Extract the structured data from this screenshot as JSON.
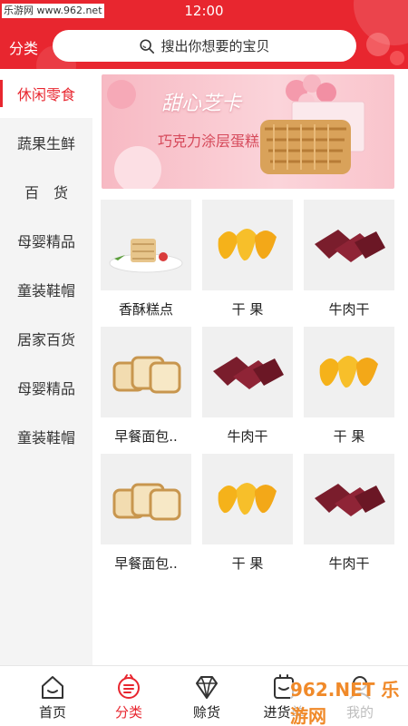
{
  "status": {
    "watermark": "乐游网 www.962.net",
    "time": "12:00"
  },
  "header": {
    "category_label": "分类",
    "search_placeholder": "搜出你想要的宝贝"
  },
  "sidebar": {
    "items": [
      {
        "label": "休闲零食",
        "active": true
      },
      {
        "label": "蔬果生鲜",
        "active": false
      },
      {
        "label": "百　货",
        "active": false
      },
      {
        "label": "母婴精品",
        "active": false
      },
      {
        "label": "童装鞋帽",
        "active": false
      },
      {
        "label": "居家百货",
        "active": false
      },
      {
        "label": "母婴精品",
        "active": false
      },
      {
        "label": "童装鞋帽",
        "active": false
      }
    ]
  },
  "banner": {
    "script_text": "甜心芝卡",
    "title": "巧克力涂层蛋糕"
  },
  "products": [
    {
      "label": "香酥糕点",
      "image": "pastry-plate"
    },
    {
      "label": "干 果",
      "image": "dried-mango"
    },
    {
      "label": "牛肉干",
      "image": "beef-jerky"
    },
    {
      "label": "早餐面包..",
      "image": "bread-slices"
    },
    {
      "label": "牛肉干",
      "image": "beef-jerky"
    },
    {
      "label": "干 果",
      "image": "dried-mango"
    },
    {
      "label": "早餐面包..",
      "image": "bread-slices"
    },
    {
      "label": "干 果",
      "image": "dried-mango"
    },
    {
      "label": "牛肉干",
      "image": "beef-jerky"
    }
  ],
  "bottom_nav": {
    "items": [
      {
        "label": "首页",
        "icon": "home-icon",
        "active": false
      },
      {
        "label": "分类",
        "icon": "category-icon",
        "active": true
      },
      {
        "label": "赊货",
        "icon": "diamond-icon",
        "active": false
      },
      {
        "label": "进货单",
        "icon": "cart-icon",
        "active": false
      },
      {
        "label": "我的",
        "icon": "user-icon",
        "active": false
      }
    ]
  },
  "watermark_br": "962.NET 乐游网",
  "colors": {
    "brand_red": "#e8262f",
    "sidebar_bg": "#f4f4f4",
    "banner_pink": "#f9c4cc"
  }
}
